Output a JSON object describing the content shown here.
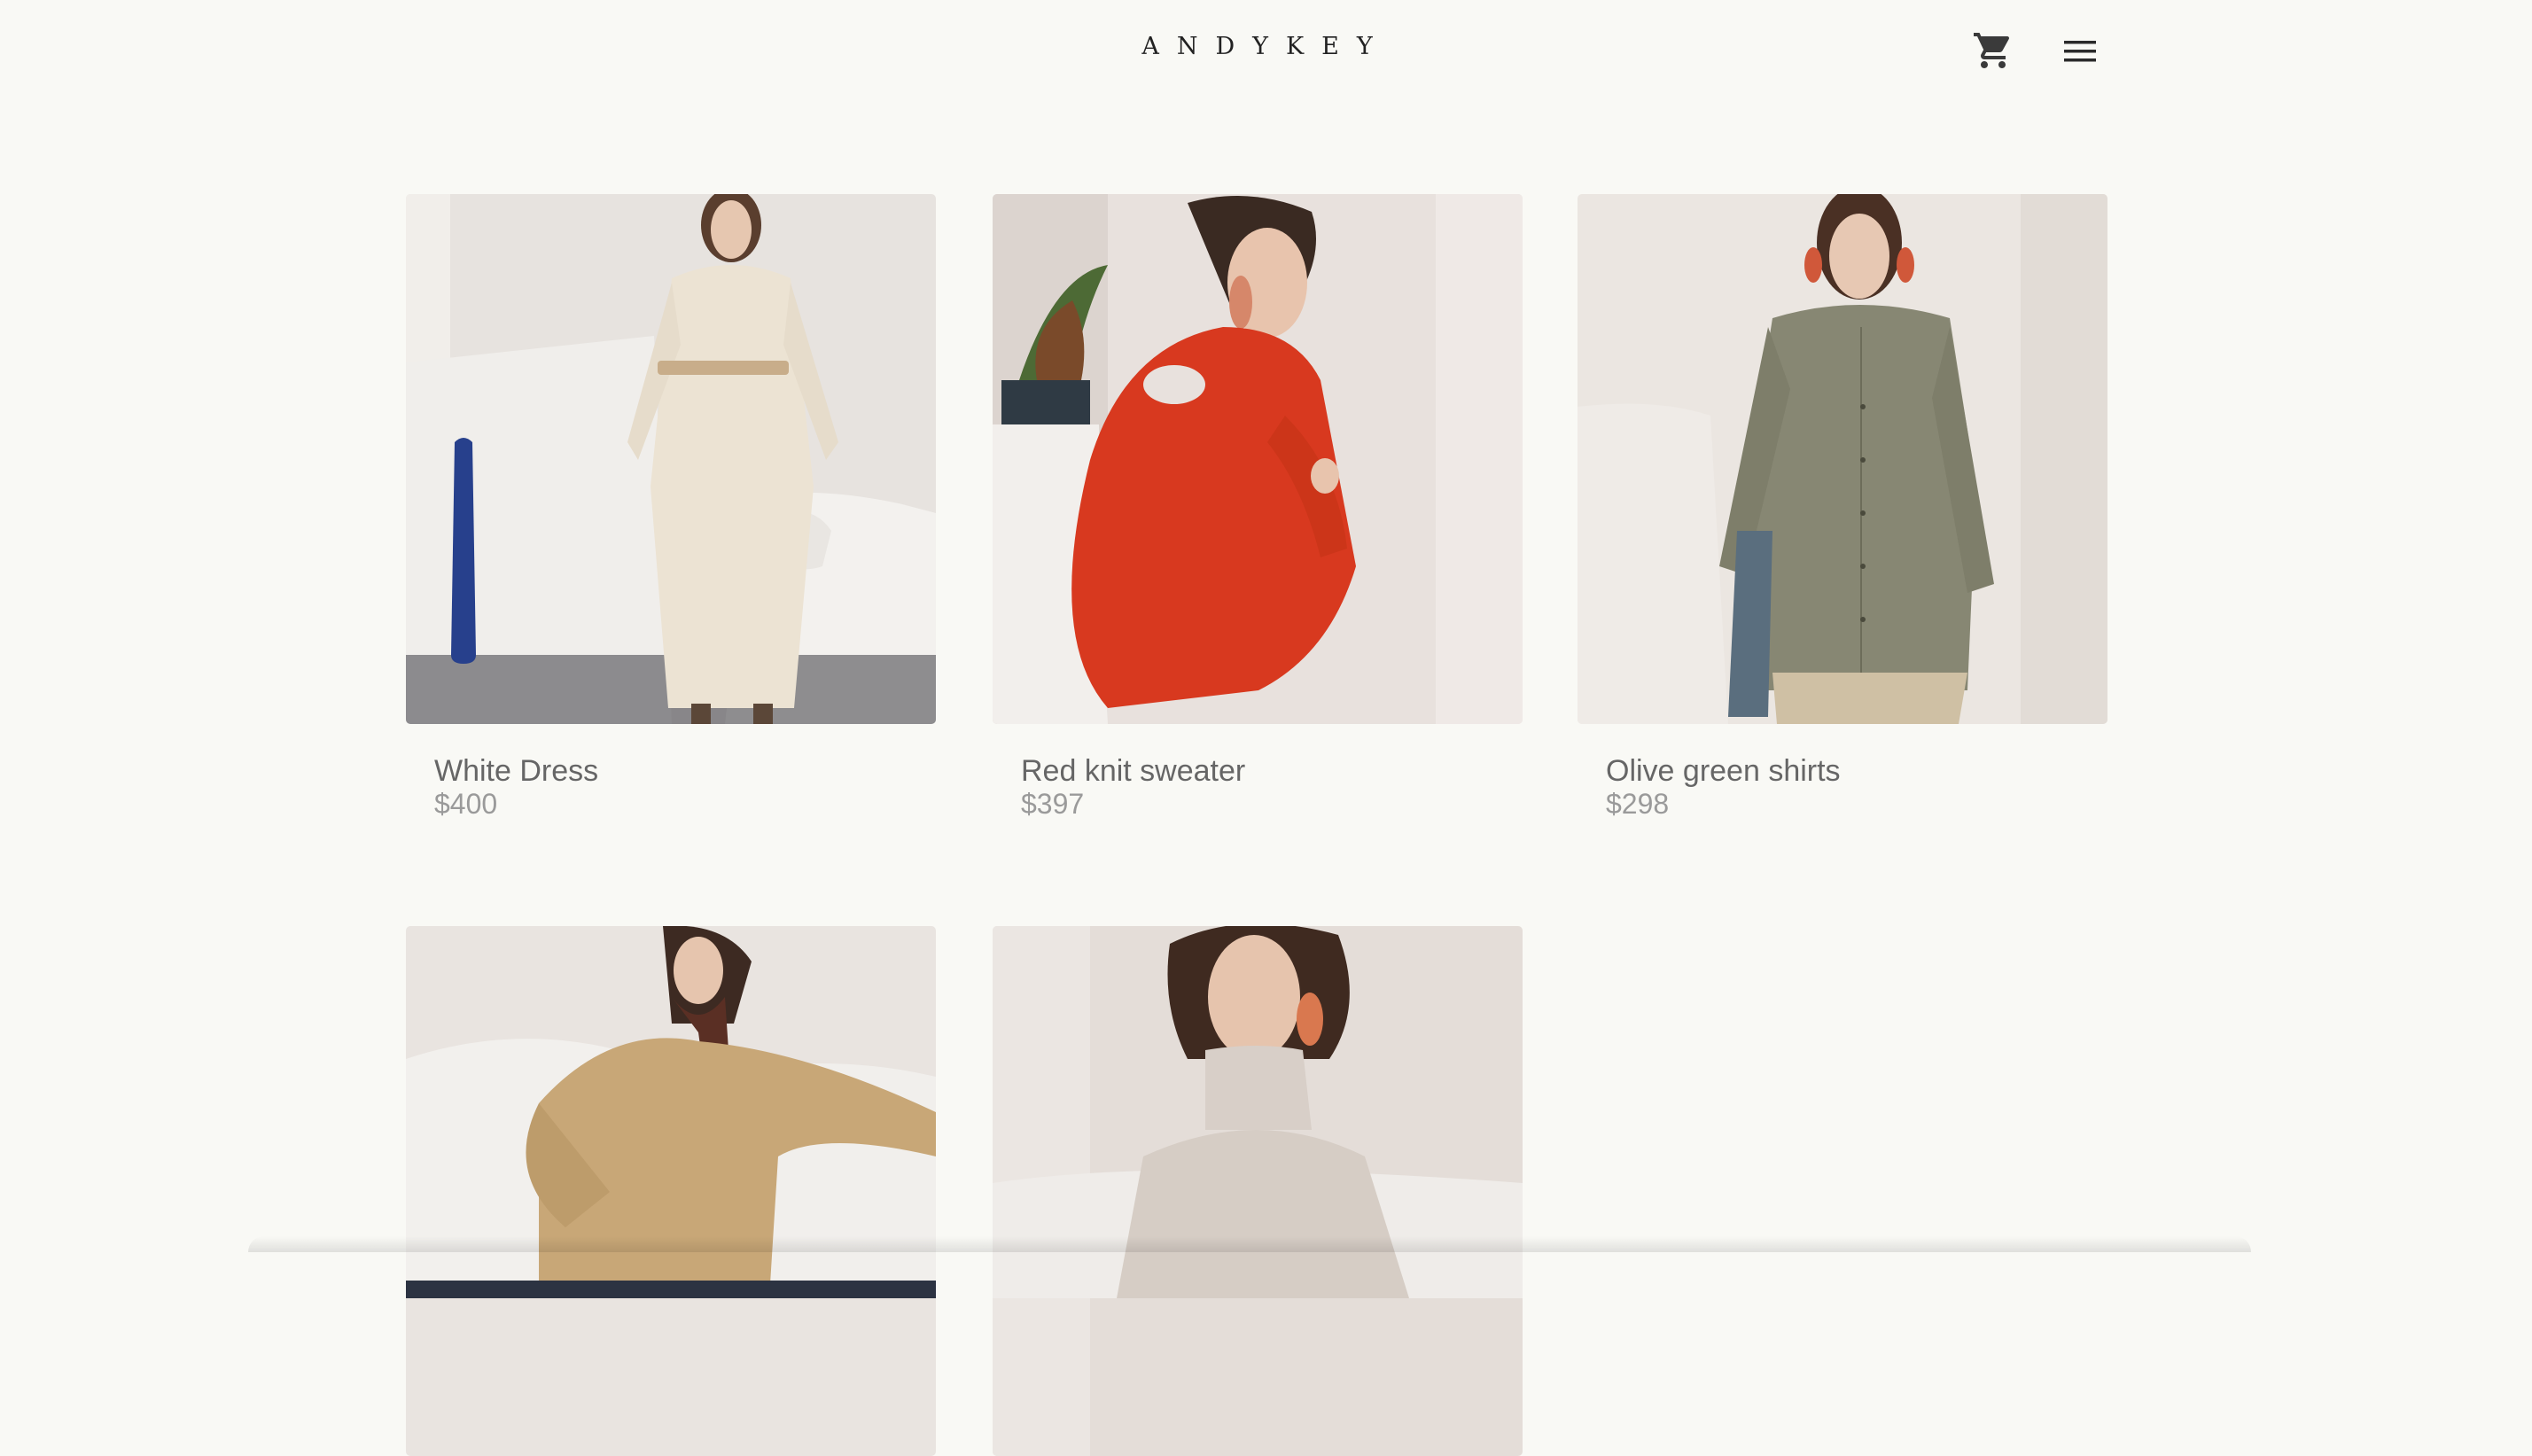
{
  "header": {
    "logo": "ANDYKEY",
    "cart_icon": "shopping-cart-icon",
    "menu_icon": "hamburger-menu-icon"
  },
  "products": [
    {
      "name": "White Dress",
      "price": "$400"
    },
    {
      "name": "Red knit sweater",
      "price": "$397"
    },
    {
      "name": "Olive green shirts",
      "price": "$298"
    },
    {
      "name": "",
      "price": ""
    },
    {
      "name": "",
      "price": ""
    }
  ],
  "colors": {
    "background": "#f9f9f5",
    "name_text": "#666666",
    "price_text": "#9a9a9a"
  }
}
